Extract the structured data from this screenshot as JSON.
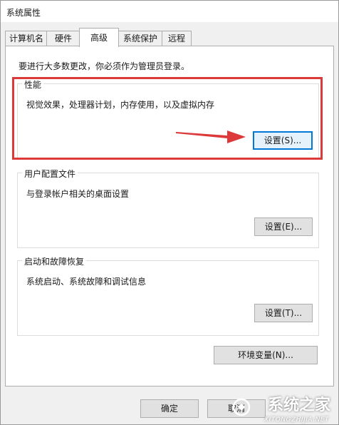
{
  "window": {
    "title": "系统属性"
  },
  "tabs": [
    {
      "label": "计算机名"
    },
    {
      "label": "硬件"
    },
    {
      "label": "高级"
    },
    {
      "label": "系统保护"
    },
    {
      "label": "远程"
    }
  ],
  "active_tab": "高级",
  "admin_notice": "要进行大多数更改，你必须作为管理员登录。",
  "performance": {
    "title": "性能",
    "description": "视觉效果，处理器计划，内存使用，以及虚拟内存",
    "button_label": "设置(S)..."
  },
  "user_profiles": {
    "title": "用户配置文件",
    "description": "与登录帐户相关的桌面设置",
    "button_label": "设置(E)..."
  },
  "startup_recovery": {
    "title": "启动和故障恢复",
    "description": "系统启动、系统故障和调试信息",
    "button_label": "设置(T)..."
  },
  "env_vars_button": "环境变量(N)...",
  "footer": {
    "ok_label": "确定",
    "cancel_label": "取消"
  },
  "watermark": {
    "main": "系统之家",
    "sub": "XITONGZHIJIA.NET"
  },
  "colors": {
    "annotation_red": "#dc3a3a",
    "focus_blue": "#0078d7",
    "panel_bg": "#ffffff",
    "window_bg": "#f0f0f0"
  }
}
